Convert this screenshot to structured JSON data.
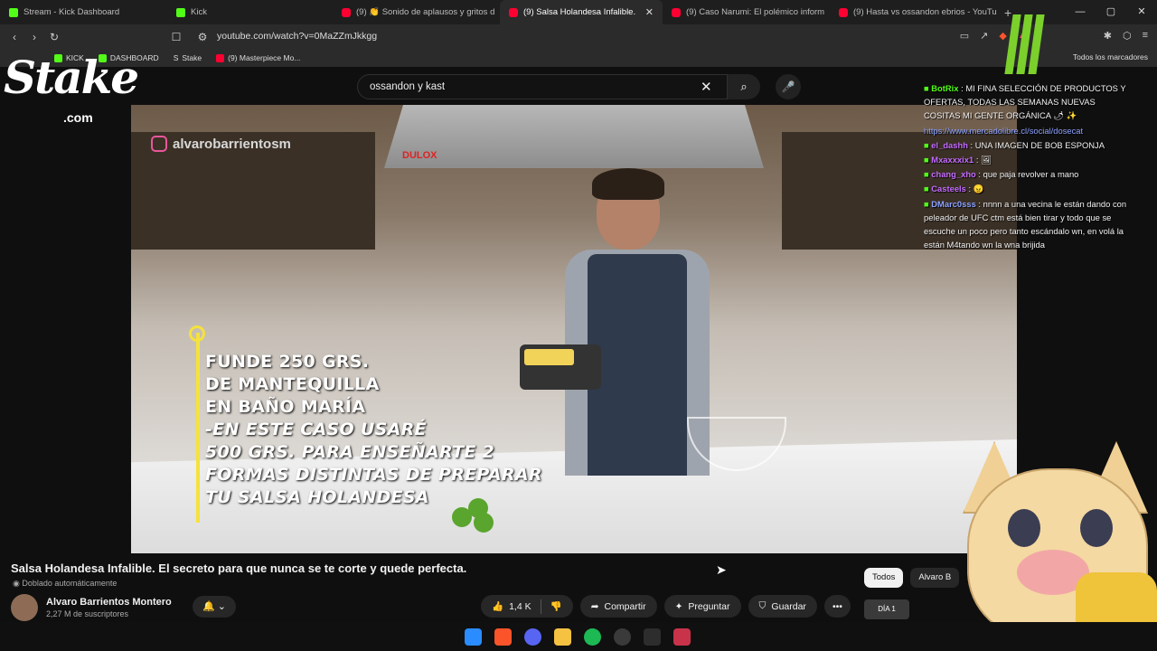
{
  "browser": {
    "tabs": [
      {
        "title": "Stream - Kick Dashboard",
        "favicon": "kick-icon",
        "active": false
      },
      {
        "title": "Kick",
        "favicon": "kick-icon",
        "active": false
      },
      {
        "title": "(9) 👏 Sonido de aplausos y gritos d",
        "favicon": "youtube-icon",
        "active": false
      },
      {
        "title": "(9) Salsa Holandesa Infalible.",
        "favicon": "youtube-icon",
        "active": true
      },
      {
        "title": "(9) Caso Narumi: El polémico inform",
        "favicon": "youtube-icon",
        "active": false
      },
      {
        "title": "(9) Hasta vs ossandon ebrios - YouTu",
        "favicon": "youtube-icon",
        "active": false
      }
    ],
    "url": "youtube.com/watch?v=0MaZZmJkkgg",
    "bookmarks": [
      {
        "label": "KICK",
        "favicon": "kick-icon"
      },
      {
        "label": "DASHBOARD",
        "favicon": "kick-icon"
      },
      {
        "label": "Stake",
        "favicon": "stake-icon"
      },
      {
        "label": "(9) Masterpiece Mo...",
        "favicon": "youtube-icon"
      }
    ],
    "bookmarks_right": "Todos los marcadores"
  },
  "youtube": {
    "search_value": "ossandon y kast",
    "video": {
      "ig_handle": "alvarobarrientosm",
      "hood_brand": "DULOX",
      "caption_lines": [
        "FUNDE 250 GRS.",
        "DE MANTEQUILLA",
        "EN BAÑO MARÍA",
        "-EN ESTE CASO USARÉ",
        "500 GRS. PARA ENSEÑARTE 2",
        "FORMAS DISTINTAS DE PREPARAR",
        "TU SALSA HOLANDESA"
      ]
    },
    "title": "Salsa Holandesa Infalible. El secreto para que nunca se te corte y quede perfecta.",
    "dub_label": "Doblado automáticamente",
    "channel": {
      "name": "Alvaro Barrientos Montero",
      "subscribers": "2,27 M de suscriptores"
    },
    "actions": {
      "likes": "1,4 K",
      "share": "Compartir",
      "ask": "Preguntar",
      "save": "Guardar"
    },
    "filters": [
      "Todos",
      "Alvaro B"
    ],
    "mini_thumb_label": "DÍA 1"
  },
  "overlay": {
    "stake_logo": "Stake",
    "stake_com": ".com",
    "chat": [
      {
        "user": "BotRix",
        "text": ": MI FINA SELECCIÓN DE PRODUCTOS Y OFERTAS, TODAS LAS SEMANAS NUEVAS COSITAS MI GENTE ORGÁNICA 🌶 ✨",
        "user_color": "#53fc18"
      },
      {
        "user": "",
        "text": "https://www.mercadolibre.cl/social/dosecat",
        "user_color": "#8da2ff",
        "is_link": true
      },
      {
        "user": "el_dashh",
        "text": ": UNA IMAGEN DE BOB ESPONJA",
        "user_color": "#c46bff"
      },
      {
        "user": "Mxaxxxix1",
        "text": ":",
        "user_color": "#c46bff"
      },
      {
        "user": "chang_xho",
        "text": ": que paja revolver a mano",
        "user_color": "#c46bff"
      },
      {
        "user": "Casteels",
        "text": ":",
        "user_color": "#c46bff"
      },
      {
        "user": "DMarc0sss",
        "text": ": nnnn a una vecina le están dando con peleador de UFC ctm está bien tirar y todo que se escuche un poco pero tanto escándalo wn, en volá la están M4tando wn la wna brijida",
        "user_color": "#8da2ff"
      }
    ]
  }
}
